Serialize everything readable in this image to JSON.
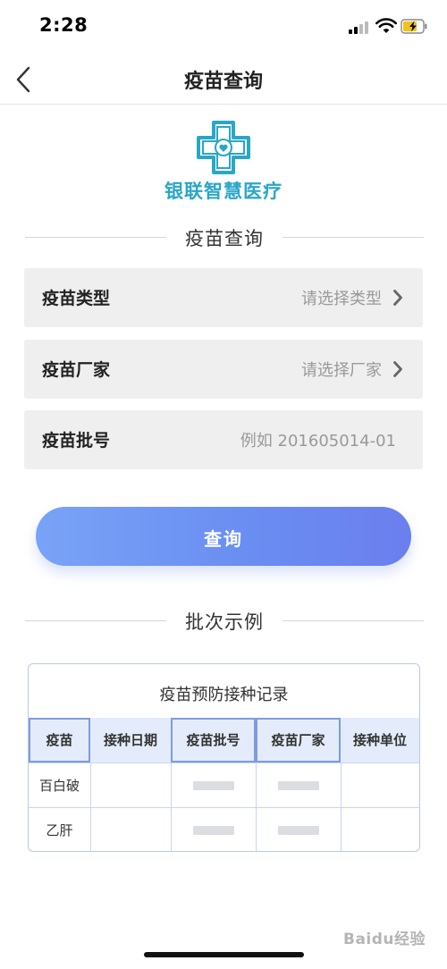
{
  "status_bar": {
    "time": "2:28"
  },
  "nav": {
    "title": "疫苗查询"
  },
  "logo": {
    "text": "银联智慧医疗"
  },
  "section1": {
    "title": "疫苗查询"
  },
  "form": {
    "type": {
      "label": "疫苗类型",
      "value": "请选择类型"
    },
    "maker": {
      "label": "疫苗厂家",
      "value": "请选择厂家"
    },
    "batch": {
      "label": "疫苗批号",
      "placeholder": "例如 201605014-01"
    }
  },
  "query_button": {
    "label": "查询"
  },
  "section2": {
    "title": "批次示例"
  },
  "example": {
    "title": "疫苗预防接种记录",
    "headers": [
      "疫苗",
      "接种日期",
      "疫苗批号",
      "疫苗厂家",
      "接种单位"
    ],
    "rows": [
      {
        "vaccine": "百白破"
      },
      {
        "vaccine": "乙肝"
      }
    ]
  },
  "watermark": {
    "text": "Baidu经验"
  },
  "colors": {
    "accent": "#6b8ef2",
    "logo": "#2aa6c9",
    "row_bg": "#efefef"
  }
}
